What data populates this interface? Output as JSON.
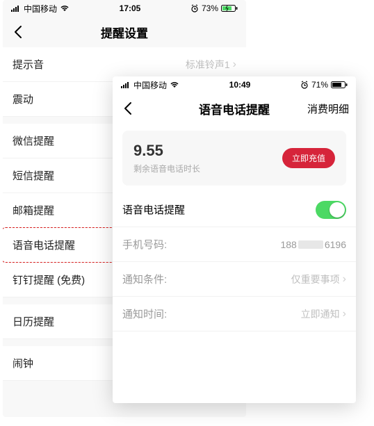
{
  "back": {
    "status": {
      "carrier": "中国移动",
      "time": "17:05",
      "battery": "73%"
    },
    "nav": {
      "title": "提醒设置"
    },
    "rows": {
      "sound": {
        "label": "提示音",
        "value": "标准铃声1"
      },
      "vibrate": {
        "label": "震动"
      },
      "wechat": {
        "label": "微信提醒"
      },
      "sms": {
        "label": "短信提醒"
      },
      "email": {
        "label": "邮箱提醒"
      },
      "voice": {
        "label": "语音电话提醒"
      },
      "ding": {
        "label": "钉钉提醒 (免费)"
      },
      "calendar": {
        "label": "日历提醒"
      },
      "alarm": {
        "label": "闹钟"
      }
    }
  },
  "front": {
    "status": {
      "carrier": "中国移动",
      "time": "10:49",
      "battery": "71%"
    },
    "nav": {
      "title": "语音电话提醒",
      "right": "消费明细"
    },
    "card": {
      "balance": "9.55",
      "balance_label": "剩余语音电话时长",
      "recharge": "立即充值"
    },
    "rows": {
      "toggle": {
        "label": "语音电话提醒"
      },
      "phone": {
        "label": "手机号码:",
        "prefix": "188",
        "suffix": "6196"
      },
      "cond": {
        "label": "通知条件:",
        "value": "仅重要事项"
      },
      "time": {
        "label": "通知时间:",
        "value": "立即通知"
      }
    }
  }
}
